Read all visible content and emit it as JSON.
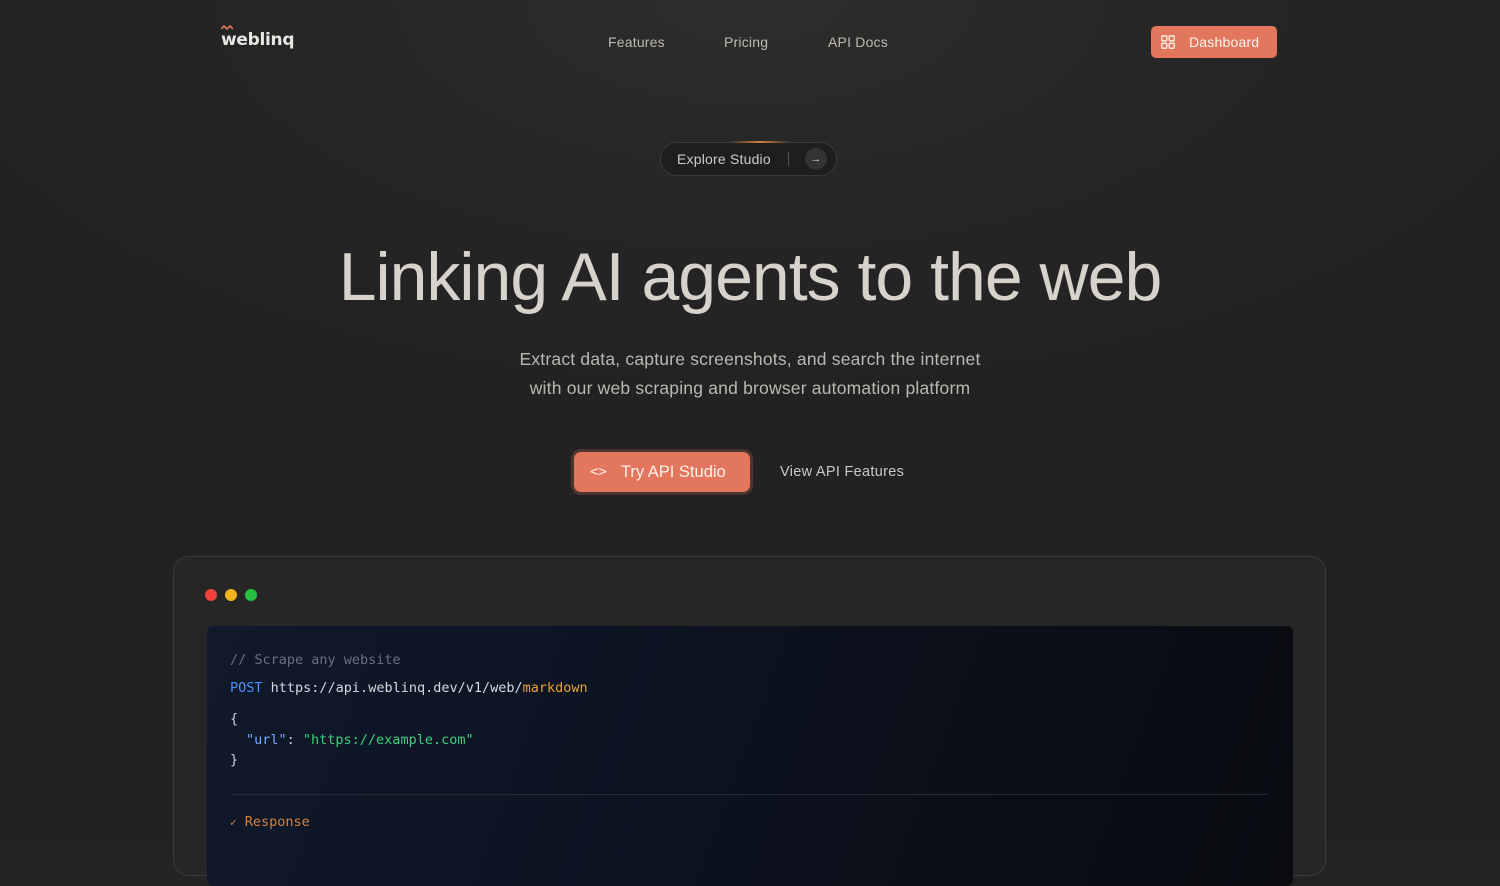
{
  "brand": {
    "name": "weblinq",
    "accent": "#e3775d"
  },
  "nav": {
    "links": [
      "Features",
      "Pricing",
      "API Docs"
    ],
    "dashboard_label": "Dashboard",
    "dashboard_icon": "dashboard-grid-icon"
  },
  "announcement": {
    "label": "Explore Studio",
    "arrow_icon": "arrow-right-icon"
  },
  "hero": {
    "title": "Linking AI agents to the web",
    "subtitle_line1": "Extract data, capture screenshots, and search the internet",
    "subtitle_line2": "with our web scraping and browser automation platform"
  },
  "cta": {
    "primary_label": "Try API Studio",
    "primary_icon": "code-brackets-icon",
    "secondary_label": "View API Features"
  },
  "code_window": {
    "comment": "// Scrape any website",
    "method": "POST",
    "url_base": "https://api.weblinq.dev/v1/web/",
    "url_endpoint": "markdown",
    "open_brace": "{",
    "key": "\"url\"",
    "colon": ": ",
    "value": "\"https://example.com\"",
    "close_brace": "}",
    "response_icon": "check-icon",
    "response_label": "Response",
    "traffic_lights": [
      "#f0413c",
      "#f3b21c",
      "#27c23f"
    ]
  }
}
